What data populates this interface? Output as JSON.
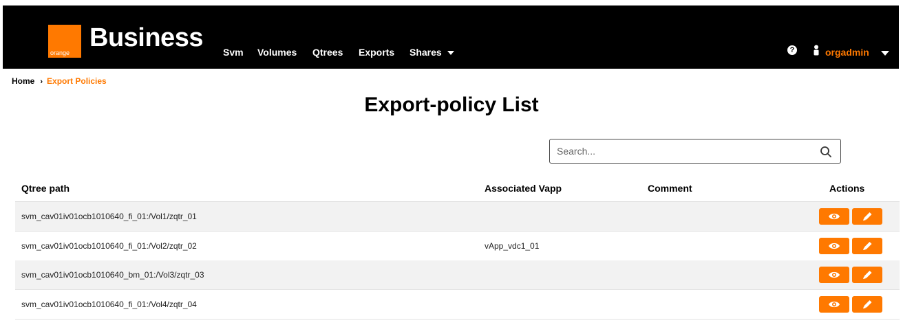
{
  "brand": {
    "name": "Business",
    "logo_text": "orange"
  },
  "nav": {
    "items": [
      {
        "label": "Svm"
      },
      {
        "label": "Volumes"
      },
      {
        "label": "Qtrees"
      },
      {
        "label": "Exports"
      },
      {
        "label": "Shares"
      }
    ],
    "help_glyph": "?",
    "user_name": "orgadmin"
  },
  "breadcrumb": {
    "home": "Home",
    "separator": "›",
    "current": "Export Policies"
  },
  "page": {
    "title": "Export-policy List"
  },
  "search": {
    "placeholder": "Search...",
    "value": ""
  },
  "table": {
    "columns": [
      "Qtree path",
      "Associated Vapp",
      "Comment",
      "Actions"
    ],
    "rows": [
      {
        "path": "svm_cav01iv01ocb1010640_fi_01:/Vol1/zqtr_01",
        "vapp": "",
        "comment": ""
      },
      {
        "path": "svm_cav01iv01ocb1010640_fi_01:/Vol2/zqtr_02",
        "vapp": "vApp_vdc1_01",
        "comment": ""
      },
      {
        "path": "svm_cav01iv01ocb1010640_bm_01:/Vol3/zqtr_03",
        "vapp": "",
        "comment": ""
      },
      {
        "path": "svm_cav01iv01ocb1010640_fi_01:/Vol4/zqtr_04",
        "vapp": "",
        "comment": ""
      }
    ],
    "actions": [
      "eye-icon",
      "pencil-icon"
    ]
  },
  "colors": {
    "accent": "#ff7900",
    "navbar": "#000000",
    "row_shade": "#f2f2f2"
  }
}
